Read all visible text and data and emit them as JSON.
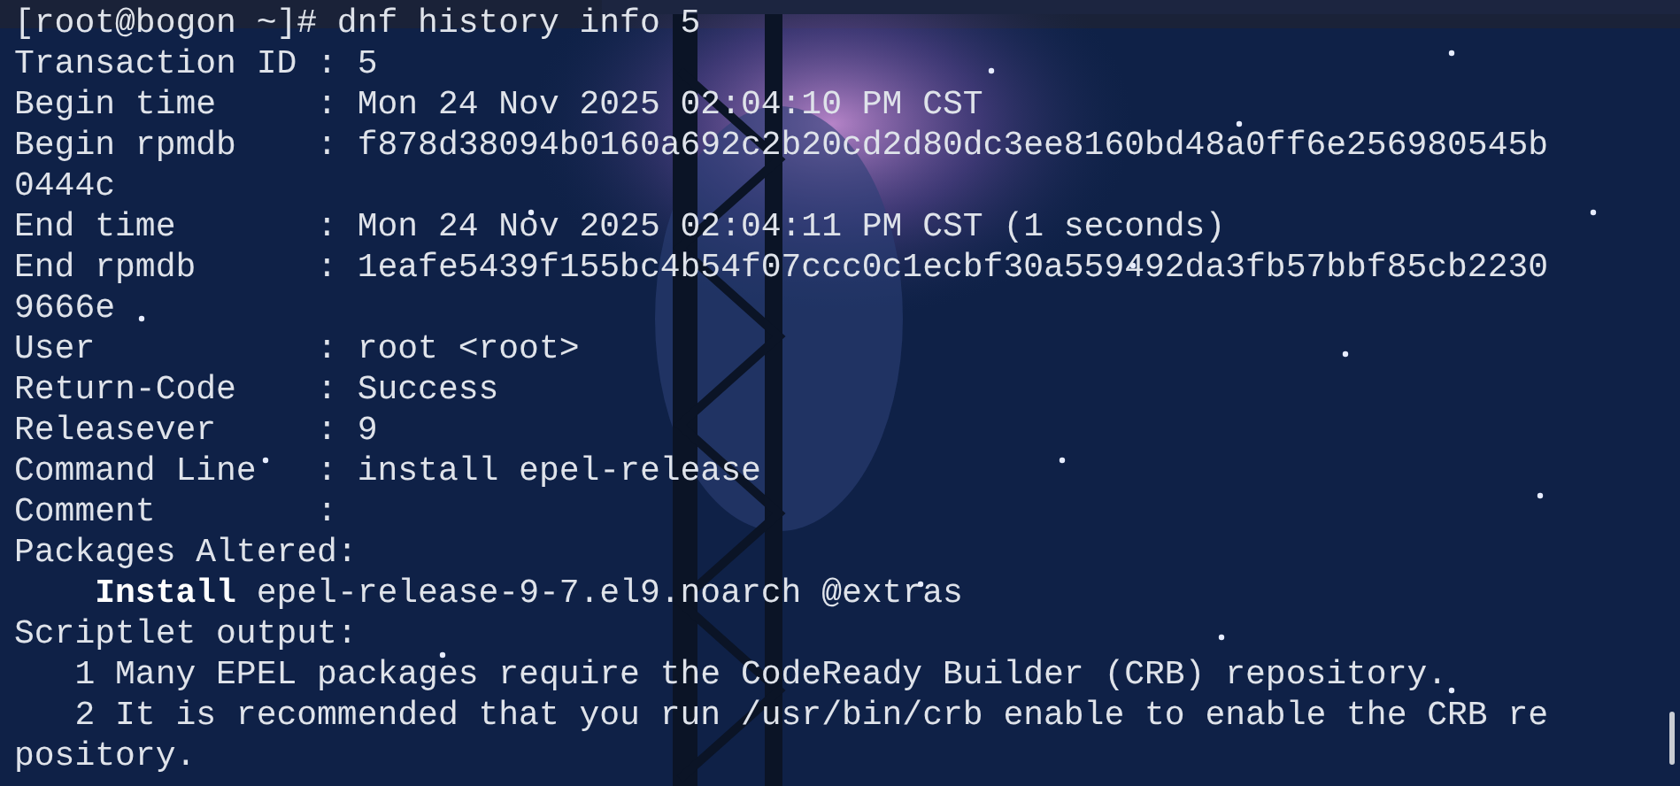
{
  "terminal": {
    "lines": [
      "[root@bogon ~]# dnf history info 5",
      "Transaction ID : 5",
      "Begin time     : Mon 24 Nov 2025 02:04:10 PM CST",
      "Begin rpmdb    : f878d38094b0160a692c2b20cd2d80dc3ee8160bd48a0ff6e256980545b",
      "0444c",
      "End time       : Mon 24 Nov 2025 02:04:11 PM CST (1 seconds)",
      "End rpmdb      : 1eafe5439f155bc4b54f07ccc0c1ecbf30a559492da3fb57bbf85cb2230",
      "9666e",
      "User           : root <root>",
      "Return-Code    : Success",
      "Releasever     : 9",
      "Command Line   : install epel-release",
      "Comment        :",
      "Packages Altered:",
      "    **Install** epel-release-9-7.el9.noarch @extras",
      "Scriptlet output:",
      "   1 Many EPEL packages require the CodeReady Builder (CRB) repository.",
      "   2 It is recommended that you run /usr/bin/crb enable to enable the CRB re",
      "pository."
    ]
  }
}
